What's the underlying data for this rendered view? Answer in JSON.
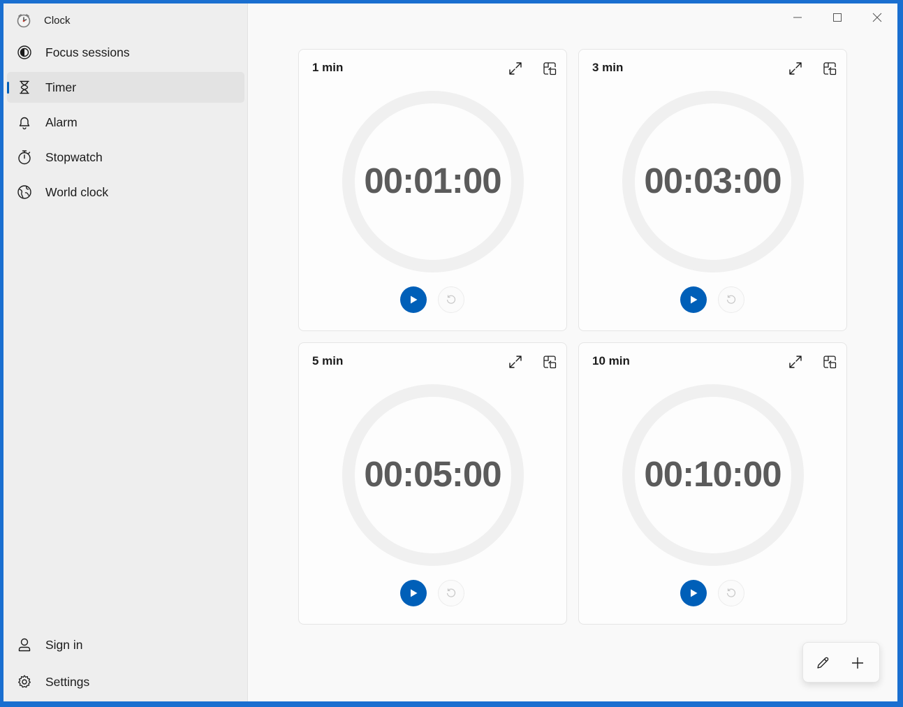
{
  "window": {
    "title": "Clock",
    "accent": "#005fb8"
  },
  "sidebar": {
    "items": [
      {
        "label": "Focus sessions",
        "icon": "focus-icon"
      },
      {
        "label": "Timer",
        "icon": "hourglass-icon",
        "selected": true
      },
      {
        "label": "Alarm",
        "icon": "bell-icon"
      },
      {
        "label": "Stopwatch",
        "icon": "stopwatch-icon"
      },
      {
        "label": "World clock",
        "icon": "globe-icon"
      }
    ],
    "footer": [
      {
        "label": "Sign in",
        "icon": "person-icon"
      },
      {
        "label": "Settings",
        "icon": "gear-icon"
      }
    ]
  },
  "timers": [
    {
      "name": "1 min",
      "time": "00:01:00"
    },
    {
      "name": "3 min",
      "time": "00:03:00"
    },
    {
      "name": "5 min",
      "time": "00:05:00"
    },
    {
      "name": "10 min",
      "time": "00:10:00"
    }
  ],
  "actions": {
    "edit_icon": "pencil-icon",
    "add_icon": "plus-icon"
  }
}
